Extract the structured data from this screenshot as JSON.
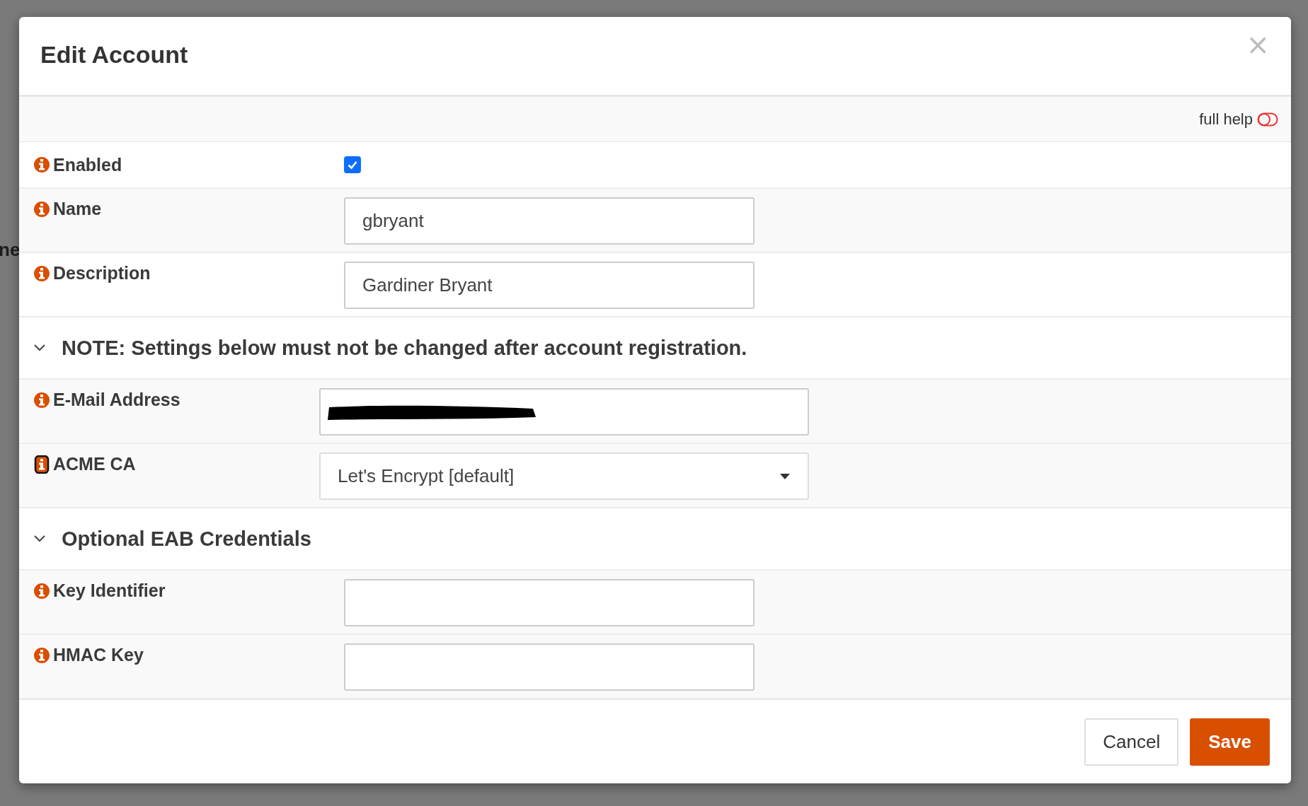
{
  "background": {
    "fragments": [
      "ne"
    ]
  },
  "dialog": {
    "title": "Edit Account",
    "close": "×",
    "full_help": {
      "label": "full help",
      "on": false
    },
    "sections": [
      {
        "rows": [
          {
            "kind": "checkbox",
            "label": "Enabled",
            "checked": true,
            "help_focused": false
          },
          {
            "kind": "text",
            "label": "Name",
            "value": "gbryant",
            "help_focused": false
          },
          {
            "kind": "text",
            "label": "Description",
            "value": "Gardiner Bryant",
            "help_focused": false
          }
        ]
      },
      {
        "heading": "NOTE: Settings below must not be changed after account registration.",
        "expanded": true,
        "rows": [
          {
            "kind": "redacted",
            "label": "E-Mail Address",
            "help_focused": false
          },
          {
            "kind": "select",
            "label": "ACME CA",
            "value": "Let's Encrypt [default]",
            "help_focused": true
          }
        ]
      },
      {
        "heading": "Optional EAB Credentials",
        "expanded": true,
        "rows": [
          {
            "kind": "text",
            "label": "Key Identifier",
            "value": "",
            "help_focused": false
          },
          {
            "kind": "text",
            "label": "HMAC Key",
            "value": "",
            "help_focused": false
          }
        ]
      }
    ],
    "buttons": [
      {
        "label": "Cancel",
        "kind": "secondary"
      },
      {
        "label": "Save",
        "kind": "primary"
      }
    ]
  }
}
